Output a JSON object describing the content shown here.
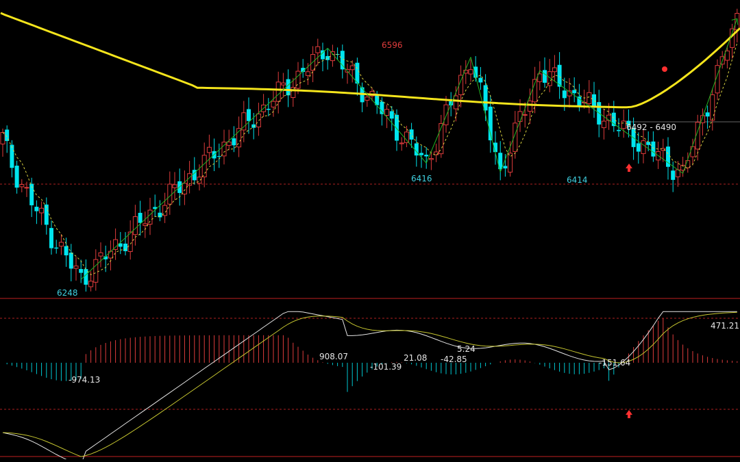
{
  "colors": {
    "background": "#000000",
    "up_candle": "#e03c3c",
    "down_candle": "#00e5ee",
    "moving_average_long": "#f5e51c",
    "moving_average_short": "#d8d040",
    "zigzag": "#22b322",
    "macd_dif": "#e6e6e6",
    "macd_dea": "#c8c830",
    "macd_hist_pos": "#e03c3c",
    "macd_hist_neg": "#00c8d2",
    "separator": "#c02020",
    "price_label_high": "#e03c3c",
    "price_label_low": "#3fd0e0",
    "value_label": "#e6e6e6",
    "signal_marker": "#ff3030"
  },
  "chart_data": [
    {
      "type": "candlestick",
      "panel": "price",
      "ylim": [
        6230,
        6680
      ],
      "indicators": [
        "moving_average_long",
        "moving_average_short",
        "zigzag"
      ],
      "grid": false,
      "annotations": {
        "high": "6596",
        "low_1": "6248",
        "low_2": "6416",
        "low_3": "6414",
        "range": "6492 - 6490"
      },
      "zigzag_points": [
        {
          "x": 16,
          "y": 6248
        },
        {
          "x": 66,
          "y": 6610
        },
        {
          "x": 86,
          "y": 6430
        },
        {
          "x": 95,
          "y": 6596
        },
        {
          "x": 101,
          "y": 6416
        },
        {
          "x": 109,
          "y": 6575
        },
        {
          "x": 138,
          "y": 6414
        },
        {
          "x": 149,
          "y": 6656
        }
      ]
    },
    {
      "type": "line+bar",
      "panel": "macd",
      "series": [
        {
          "key": "dif",
          "role": "line"
        },
        {
          "key": "dea",
          "role": "line"
        },
        {
          "key": "hist",
          "role": "bar"
        }
      ],
      "value_labels": [
        "-974.13",
        "908.07",
        "-101.39",
        "21.08",
        "-42.85",
        "5.24",
        "-151.64",
        "471.21"
      ]
    }
  ]
}
